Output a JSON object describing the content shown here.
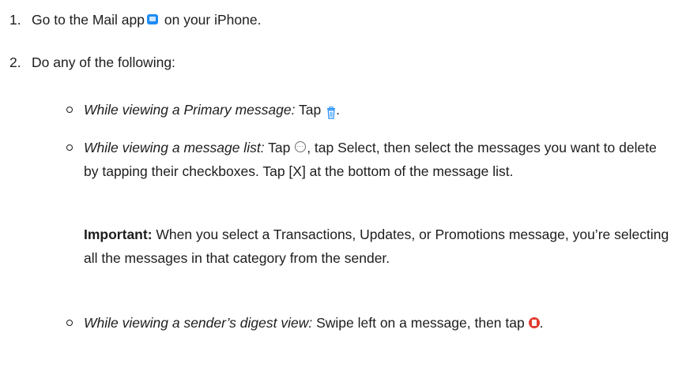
{
  "steps": [
    {
      "number": "1.",
      "text_before": "Go to the Mail app",
      "icon": "mail-app-icon",
      "text_after": " on your iPhone."
    },
    {
      "number": "2.",
      "text": "Do any of the following:"
    }
  ],
  "bullets": [
    {
      "label": "While viewing a Primary message:",
      "text_before": " Tap ",
      "icon": "trash-icon",
      "text_after": "."
    },
    {
      "label": "While viewing a message list:",
      "text_before": " Tap ",
      "icon": "more-icon",
      "text_after": ", tap Select, then select the messages you want to delete by tapping their checkboxes. Tap [X] at the bottom of the message list."
    },
    {
      "label": "While viewing a sender’s digest view:",
      "text_before": " Swipe left on a message, then tap ",
      "icon": "red-trash-icon",
      "text_after": "."
    }
  ],
  "important": {
    "label": "Important:",
    "text": " When you select a Transactions, Updates, or Promotions message, you’re selecting all the messages in that category from the sender."
  },
  "colors": {
    "text": "#1d1d1f",
    "mail_icon": "#1e8cf5",
    "red_trash": "#e23b2e"
  }
}
